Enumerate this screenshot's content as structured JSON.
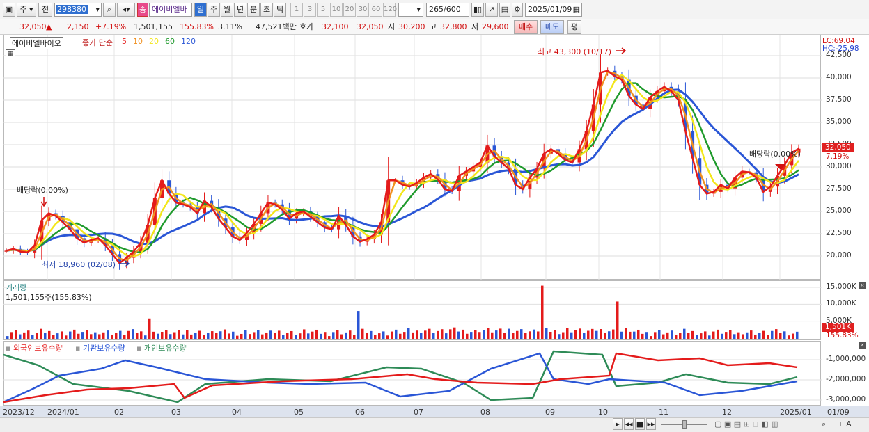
{
  "toolbar": {
    "market": "주",
    "prev_label": "전",
    "code": "298380",
    "name_badge": "종",
    "stock_name": "에이비엘바",
    "periods": [
      "일",
      "주",
      "월",
      "년",
      "분",
      "초",
      "틱"
    ],
    "period_active": "일",
    "intervals": [
      "1",
      "3",
      "5",
      "10",
      "20",
      "30",
      "60",
      "120"
    ],
    "count": "265",
    "count_total": "/600",
    "date": "2025/01/09"
  },
  "quote": {
    "price": "32,050",
    "arrow": "▲",
    "change": "2,150",
    "change_pct": "+7.19%",
    "volume": "1,501,155",
    "volume_ratio": "155.83%",
    "turnover": "3.11%",
    "amount": "47,521백만",
    "ask_label": "호가",
    "ask": "32,100",
    "bid": "32,050",
    "open_label": "시",
    "open": "30,200",
    "high_label": "고",
    "high": "32,800",
    "low_label": "저",
    "low": "29,600",
    "buy_button": "매수",
    "sell_button": "매도",
    "eval_button": "평"
  },
  "price_pane": {
    "legend_name": "에이비엘바이오",
    "ma_title": "종가 단순",
    "ma_periods": [
      {
        "label": "5",
        "color": "#e41b1b"
      },
      {
        "label": "10",
        "color": "#f09020"
      },
      {
        "label": "20",
        "color": "#f3e61a"
      },
      {
        "label": "60",
        "color": "#1f9a2c"
      },
      {
        "label": "120",
        "color": "#2a56d6"
      }
    ],
    "lc": "LC:69.04",
    "hc": "HC:-25.98",
    "ticks": [
      "42,500",
      "40,000",
      "37,500",
      "35,000",
      "32,500",
      "30,000",
      "27,500",
      "25,000",
      "22,500",
      "20,000"
    ],
    "high_note": "최고 43,300 (10/17)",
    "low_note": "최저 18,960 (02/08)",
    "dividend_1": "배당락(0.00%)",
    "dividend_2": "배당락(0.00%)",
    "last_price": "32,050",
    "last_pct": "7.19%"
  },
  "volume_pane": {
    "title": "거래량",
    "value": "1,501,155주(155.83%)",
    "ticks": [
      "15,000K",
      "10,000K",
      "5,000K"
    ],
    "last": "1,501K",
    "last_pct": "155.83%"
  },
  "holding_pane": {
    "labels": [
      "외국인보유수량",
      "기관보유수량",
      "개인보유수량"
    ],
    "colors": [
      "#e41b1b",
      "#2a56d6",
      "#2e8b57"
    ],
    "ticks": [
      "-1,000,000",
      "-2,000,000",
      "-3,000,000"
    ]
  },
  "x_axis": [
    "2023/12",
    "2024/01",
    "02",
    "03",
    "04",
    "05",
    "06",
    "07",
    "08",
    "09",
    "10",
    "11",
    "12",
    "2025/01"
  ],
  "right_x_label": "01/09",
  "chart_data": {
    "type": "candlestick",
    "price_series": [
      20600,
      20800,
      20500,
      20400,
      21200,
      24000,
      24800,
      24500,
      23800,
      23000,
      22000,
      21500,
      21800,
      22000,
      21200,
      20200,
      19200,
      19800,
      20500,
      21500,
      23500,
      26500,
      28500,
      27000,
      26000,
      25800,
      25500,
      24800,
      26200,
      25500,
      24200,
      23200,
      22200,
      21800,
      22600,
      23600,
      24800,
      26000,
      25800,
      25200,
      24200,
      24800,
      25000,
      24400,
      23800,
      23200,
      23000,
      24500,
      23500,
      22200,
      21600,
      21900,
      22400,
      23800,
      28500,
      28500,
      28000,
      27800,
      28200,
      28800,
      29200,
      28600,
      27500,
      27300,
      29000,
      29500,
      30000,
      30500,
      32400,
      31200,
      30500,
      29800,
      28000,
      27500,
      28800,
      29800,
      31500,
      32000,
      31500,
      30800,
      30500,
      32000,
      34000,
      37000,
      40600,
      40800,
      40200,
      39800,
      38000,
      37000,
      36500,
      37800,
      38500,
      39000,
      38500,
      37500,
      34000,
      31000,
      28000,
      27000,
      27200,
      28000,
      27600,
      28800,
      29500,
      29400,
      28800,
      27200,
      27800,
      29000,
      30200,
      31600,
      32050
    ],
    "volume_spikes_K": [
      {
        "at": "03",
        "value": 5800
      },
      {
        "at": "07",
        "value": 8000
      },
      {
        "at": "09",
        "value": 15500
      },
      {
        "at": "10",
        "value": 10800
      }
    ],
    "last_volume_K": 1501
  }
}
